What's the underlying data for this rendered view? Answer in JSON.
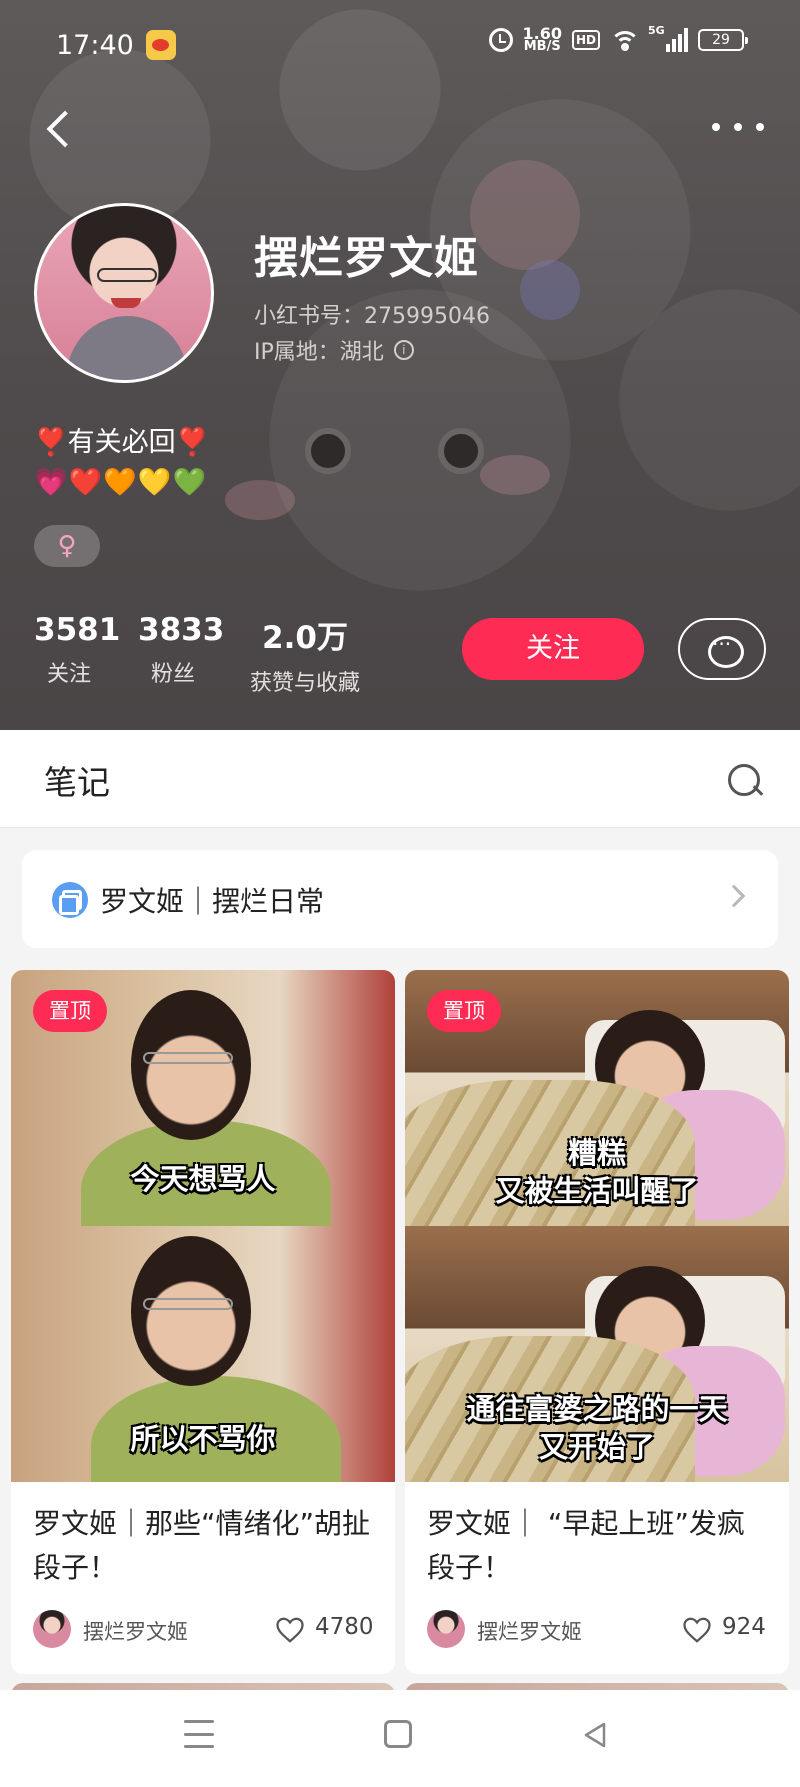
{
  "status_bar": {
    "time": "17:40",
    "net_speed_value": "1.60",
    "net_speed_unit": "MB/S",
    "hd_label": "HD",
    "network_label": "5G",
    "battery": "29"
  },
  "profile": {
    "nickname": "摆烂罗文姬",
    "user_id": "小红书号：275995046",
    "ip_location": "IP属地：湖北",
    "bio_line1": "❣️有关必回❣️",
    "bio_line2": "💗❤️🧡💛💚",
    "gender": "♀",
    "stats": [
      {
        "value": "3581",
        "label": "关注"
      },
      {
        "value": "3833",
        "label": "粉丝"
      },
      {
        "value": "2.0万",
        "label": "获赞与收藏"
      }
    ],
    "follow_label": "关注"
  },
  "tabs": {
    "notes_label": "笔记"
  },
  "collection": {
    "title": "罗文姬｜摆烂日常"
  },
  "notes": [
    {
      "pinned_label": "置顶",
      "caption_top": "今天想骂人",
      "caption_bottom": "所以不骂你",
      "title": "罗文姬｜那些“情绪化”胡扯段子！",
      "author": "摆烂罗文姬",
      "likes": "4780"
    },
    {
      "pinned_label": "置顶",
      "caption_top_line1": "糟糕",
      "caption_top_line2": "又被生活叫醒了",
      "caption_bottom_line1": "通往富婆之路的一天",
      "caption_bottom_line2": "又开始了",
      "title": "罗文姬｜ “早起上班”发疯段子！",
      "author": "摆烂罗文姬",
      "likes": "924"
    }
  ],
  "colors": {
    "accent": "#fe2c55",
    "header_bg": "#4f4a4b",
    "collection_icon": "#5b9df0"
  }
}
